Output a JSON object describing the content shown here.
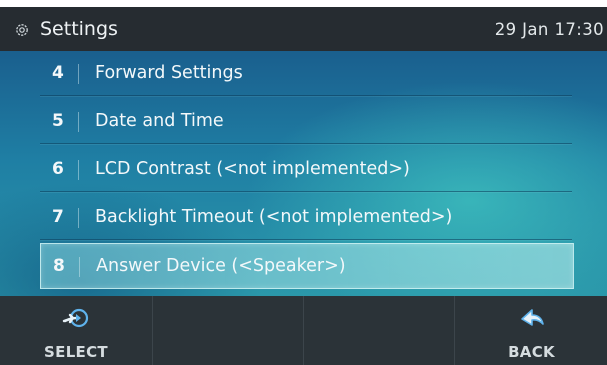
{
  "header": {
    "title": "Settings",
    "datetime": "29 Jan 17:30",
    "icon": "gear-icon"
  },
  "menu": {
    "items": [
      {
        "number": "4",
        "label": "Forward Settings"
      },
      {
        "number": "5",
        "label": "Date and Time"
      },
      {
        "number": "6",
        "label": "LCD Contrast (<not implemented>)"
      },
      {
        "number": "7",
        "label": "Backlight Timeout (<not implemented>)"
      },
      {
        "number": "8",
        "label": "Answer Device (<Speaker>)",
        "selected": true
      }
    ]
  },
  "softkeys": {
    "select": {
      "label": "SELECT",
      "icon": "select-arrow-icon"
    },
    "back": {
      "label": "BACK",
      "icon": "back-arrow-icon"
    }
  },
  "colors": {
    "accent": "#2b98aa",
    "titlebar": "#262c31",
    "softkey_bar": "#2b3338",
    "icon_blue": "#5fb3ec"
  }
}
